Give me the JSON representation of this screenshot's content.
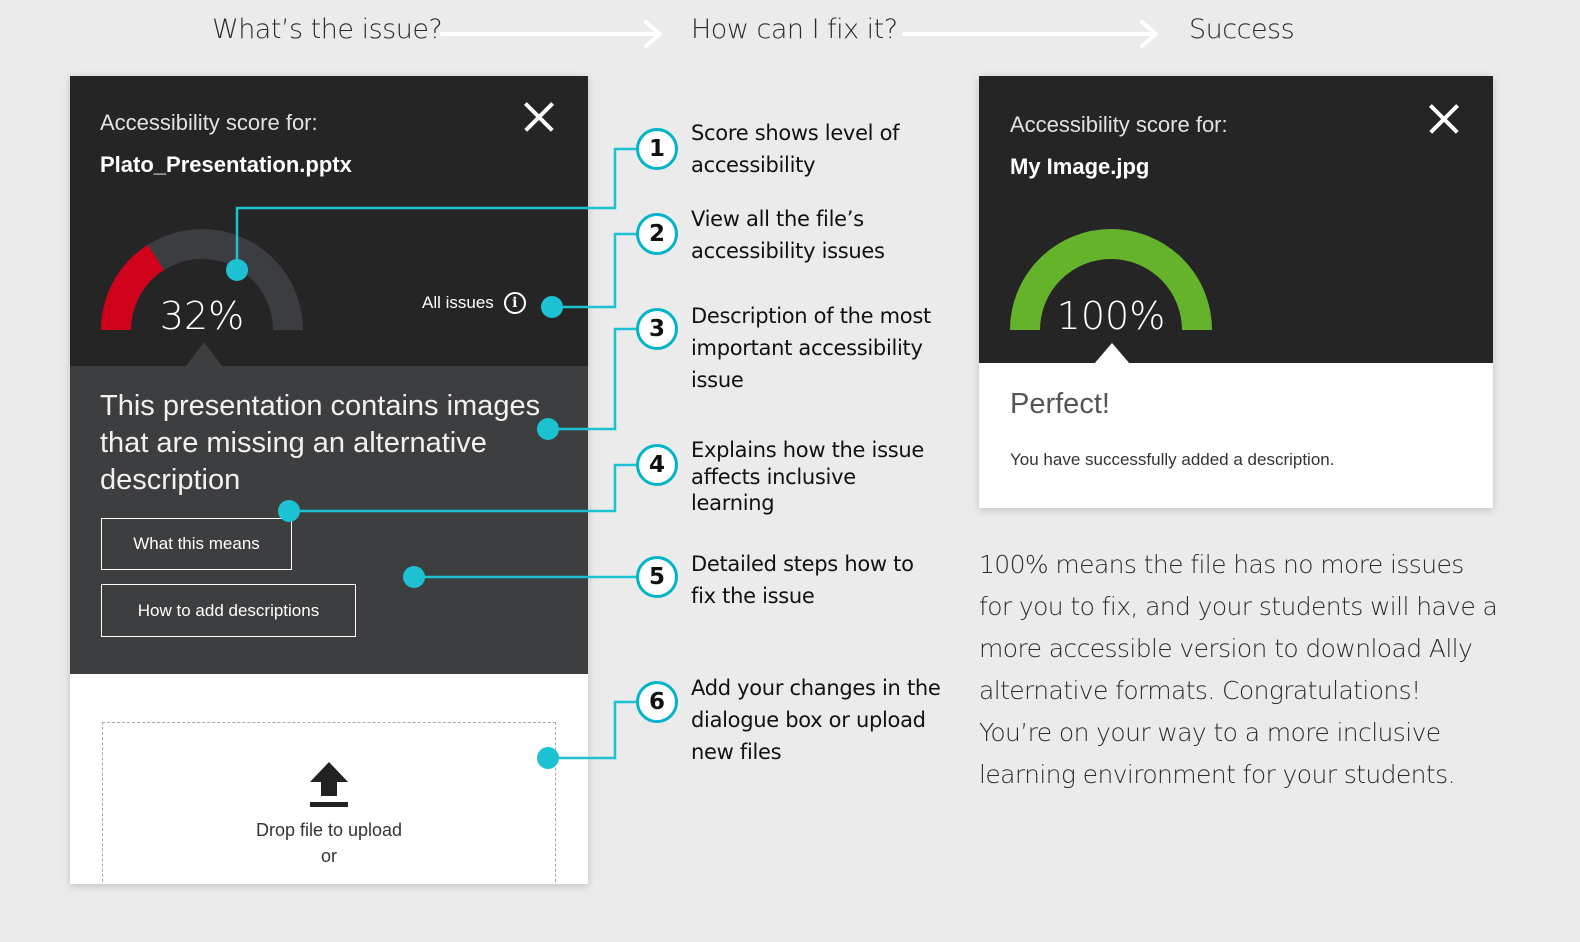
{
  "steps": [
    {
      "title": "What’s the issue?"
    },
    {
      "title": "How can I fix it?"
    },
    {
      "title": "Success"
    }
  ],
  "left_panel": {
    "score_label": "Accessibility score for:",
    "file_name": "Plato_Presentation.pptx",
    "score_percent": 32,
    "score_text": "32%",
    "all_issues_label": "All issues",
    "issue_description": "This presentation contains images that are missing an alternative description",
    "what_this_means_button": "What this means",
    "how_to_add_button": "How to add descriptions",
    "drop_text": "Drop file to upload",
    "or_text": "or"
  },
  "callouts": [
    {
      "number": "1",
      "text": "Score shows level of accessibility"
    },
    {
      "number": "2",
      "text": "View all the file’s accessibility issues"
    },
    {
      "number": "3",
      "text": "Description of the most important accessibility issue"
    },
    {
      "number": "4",
      "text": "Explains how the issue affects inclusive learning"
    },
    {
      "number": "5",
      "text": "Detailed steps how to fix the issue"
    },
    {
      "number": "6",
      "text": "Add your changes in the dialogue box or upload new files"
    }
  ],
  "right_panel": {
    "score_label": "Accessibility score for:",
    "file_name": "My Image.jpg",
    "score_percent": 100,
    "score_text": "100%",
    "result_title": "Perfect!",
    "result_message": "You have successfully added a description."
  },
  "success_description": "100% means the file has no more issues for you to fix, and your students will have a more accessible version to download Ally alternative formats. Congratulations! You’re on your way to a more inclusive learning environment for your students.",
  "colors": {
    "accent": "#1cc2d2",
    "score_low": "#d0021b",
    "score_full": "#64b32a",
    "panel_dark": "#252525",
    "panel_grey": "#3d3e40",
    "page_bg": "#ebebeb"
  },
  "icons": {
    "close": "close-icon",
    "info": "info-icon",
    "upload": "upload-icon",
    "arrow": "arrow-right-icon"
  }
}
